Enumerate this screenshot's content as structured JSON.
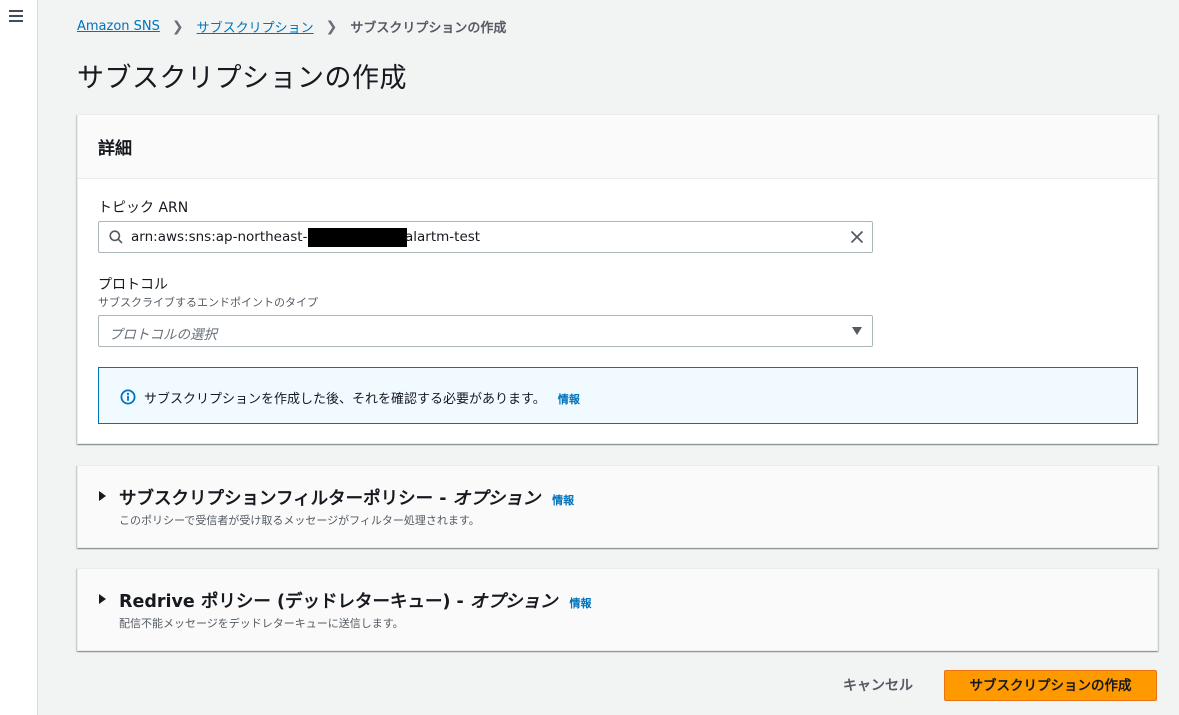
{
  "nav": {
    "menu_icon": "hamburger-menu-icon"
  },
  "breadcrumb": {
    "items": [
      "Amazon SNS",
      "サブスクリプション"
    ],
    "current": "サブスクリプションの作成",
    "separator_icon": "chevron-right-icon"
  },
  "page": {
    "title": "サブスクリプションの作成"
  },
  "details": {
    "header": "詳細",
    "topic_arn": {
      "label": "トピック ARN",
      "value_prefix": "arn:aws:sns:ap-northeast-1:",
      "value_suffix": "alartm-test",
      "search_icon": "search-icon",
      "clear_icon": "close-icon"
    },
    "protocol": {
      "label": "プロトコル",
      "description": "サブスクライブするエンドポイントのタイプ",
      "placeholder": "プロトコルの選択",
      "dropdown_icon": "caret-down-icon"
    },
    "alert": {
      "icon": "info-circle-icon",
      "message": "サブスクリプションを作成した後、それを確認する必要があります。",
      "link": "情報"
    }
  },
  "filter_policy": {
    "title_main": "サブスクリプションフィルターポリシー - ",
    "title_optional": "オプション",
    "info_link": "情報",
    "description": "このポリシーで受信者が受け取るメッセージがフィルター処理されます。"
  },
  "redrive_policy": {
    "title_main": "Redrive ポリシー (デッドレターキュー) - ",
    "title_optional": "オプション",
    "info_link": "情報",
    "description": "配信不能メッセージをデッドレターキューに送信します。"
  },
  "actions": {
    "cancel": "キャンセル",
    "create": "サブスクリプションの作成"
  },
  "colors": {
    "link": "#0073bb",
    "primary_button": "#ff9900",
    "alert_background": "#f1faff"
  }
}
